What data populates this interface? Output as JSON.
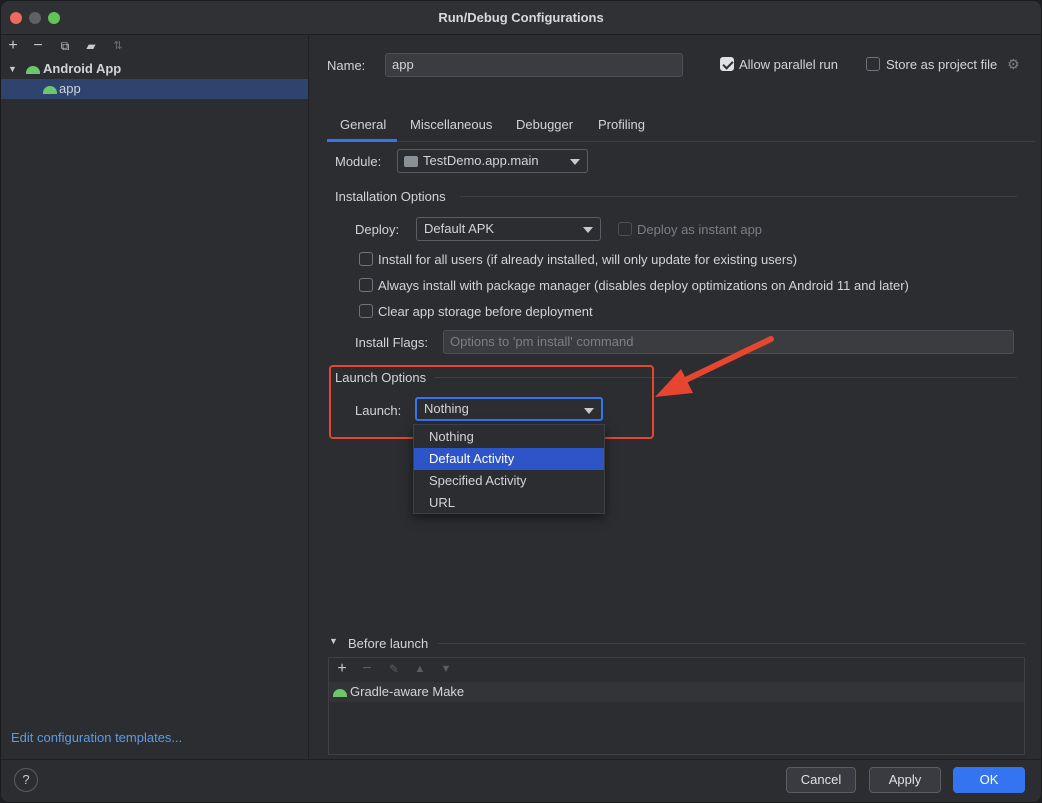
{
  "window": {
    "title": "Run/Debug Configurations"
  },
  "left": {
    "toolbar": [
      "add-icon",
      "remove-icon",
      "copy-icon",
      "folder-icon",
      "sort-icon"
    ],
    "tree": {
      "group": "Android App",
      "item": "app"
    },
    "edit_templates": "Edit configuration templates..."
  },
  "config": {
    "name_label": "Name:",
    "name_value": "app",
    "allow_parallel": "Allow parallel run",
    "store_project": "Store as project file"
  },
  "tabs": [
    "General",
    "Miscellaneous",
    "Debugger",
    "Profiling"
  ],
  "general": {
    "module_label": "Module:",
    "module_value": "TestDemo.app.main",
    "installation_title": "Installation Options",
    "deploy_label": "Deploy:",
    "deploy_value": "Default APK",
    "instant_app": "Deploy as instant app",
    "install_all_users": "Install for all users (if already installed, will only update for existing users)",
    "always_install_pm": "Always install with package manager (disables deploy optimizations on Android 11 and later)",
    "clear_storage": "Clear app storage before deployment",
    "flags_label": "Install Flags:",
    "flags_placeholder": "Options to 'pm install' command",
    "launch_title": "Launch Options",
    "launch_label": "Launch:",
    "launch_value": "Nothing",
    "launch_options": [
      "Nothing",
      "Default Activity",
      "Specified Activity",
      "URL"
    ]
  },
  "before_launch": {
    "title": "Before launch",
    "task": "Gradle-aware Make"
  },
  "footer": {
    "help": "?",
    "cancel": "Cancel",
    "apply": "Apply",
    "ok": "OK"
  },
  "colors": {
    "accent": "#3574f0",
    "annotation": "#e6452f",
    "android": "#6dc66e"
  }
}
